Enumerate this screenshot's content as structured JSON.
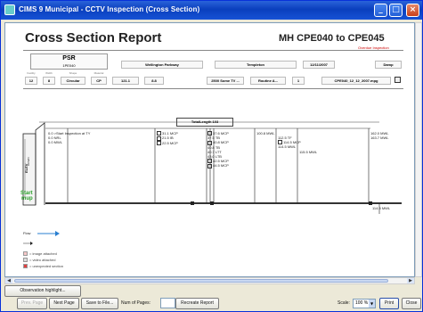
{
  "window": {
    "title": "CIMS 9 Municipal - CCTV Inspection (Cross Section)"
  },
  "report": {
    "title": "Cross Section Report",
    "mh_title": "MH CPE040 to CPE045",
    "overdue": "Overdue Inspection"
  },
  "psr": {
    "label": "PSR",
    "value": "1PE040"
  },
  "fields_row1": [
    {
      "value": "Wellington Parkway"
    },
    {
      "value": "Templeton"
    },
    {
      "value": "12/11/2007"
    },
    {
      "value": "Damp"
    }
  ],
  "fields_row2": [
    {
      "label": "Facility",
      "value": "12"
    },
    {
      "label": "Width",
      "value": "8"
    },
    {
      "label": "Shape",
      "value": "Circular"
    },
    {
      "label": "Material",
      "value": "CP"
    },
    {
      "value": "121.1"
    },
    {
      "value": "8.8"
    },
    {
      "value": "2500 Some TV ..."
    },
    {
      "value": "Routine A..."
    },
    {
      "value": "1"
    },
    {
      "value": "CPE040_12_12_2007.mpg"
    }
  ],
  "chart": {
    "total_length": "TotalLength 103",
    "side_label": "ELEV",
    "left_label": "DOWN",
    "start_label": "Start",
    "start_label2": "mup",
    "flow_label": "Flow",
    "end_label": "114.5 MWL",
    "observations": [
      {
        "lines": [
          "0.0 >Start Inspection at TY",
          "0.0 NRL",
          "0.0 MWL"
        ]
      },
      {
        "lines": [
          "31.1 MCP",
          "21.5 IB",
          "22.5 MCP"
        ]
      },
      {
        "lines": [
          "37.6 MCP",
          "37.5 TB",
          "40.8 MCP",
          "40.8 TB",
          "40.7 LTT",
          "43.0 LTB",
          "42.5 MCP",
          "44.5 MCP"
        ]
      },
      {
        "lines": [
          "100.8 MWL"
        ]
      },
      {
        "lines": [
          "112.5 TF",
          "114.5 MCP",
          "114.5 MWL"
        ]
      },
      {
        "lines": [
          "115.5 MWL"
        ]
      },
      {
        "lines": [
          "162.0 MWL",
          "163.7 MWL"
        ]
      }
    ]
  },
  "legend": [
    {
      "text": "= image attached",
      "color": "#f6c7c7"
    },
    {
      "text": "= video attached",
      "color": "#dddddd"
    },
    {
      "text": "= unexpected section",
      "color": "#e04040"
    }
  ],
  "toolbar": {
    "observation_btn": "Observation highlight...",
    "prev_page": "Prev. Page",
    "next_page": "Next Page",
    "save_file": "Save to File...",
    "num_pages_label": "Num of Pages:",
    "recreate": "Recreate Report",
    "scale_label": "Scale:",
    "scale_value": "100 %",
    "print": "Print",
    "close": "Close"
  }
}
